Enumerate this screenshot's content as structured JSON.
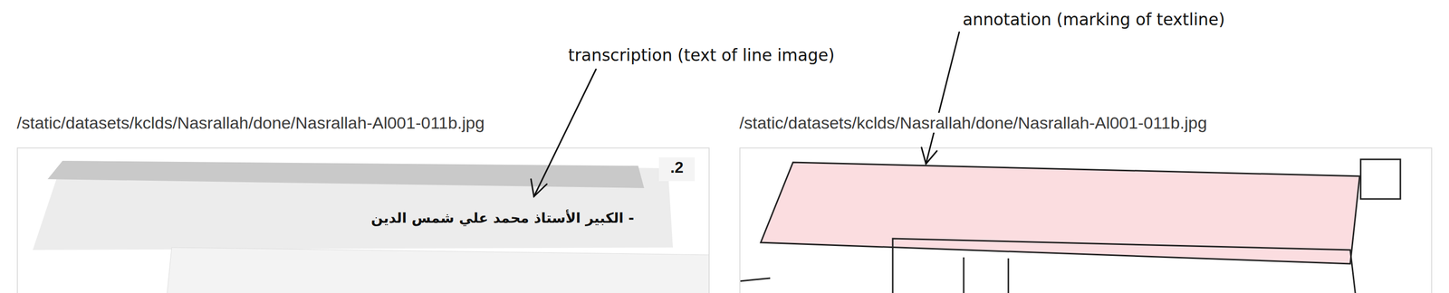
{
  "callouts": [
    {
      "label": "transcription (text of line image)",
      "target": "transcription"
    },
    {
      "label": "annotation (marking of textline)",
      "target": "annotation"
    }
  ],
  "panels": [
    {
      "kind": "transcription",
      "path": "/static/datasets/kclds/Nasrallah/done/Nasrallah-Al001-011b.jpg",
      "badge": ".2",
      "text": "- الكبير الأستاذ محمد علي شمس الدين"
    },
    {
      "kind": "annotation",
      "path": "/static/datasets/kclds/Nasrallah/done/Nasrallah-Al001-011b.jpg"
    }
  ]
}
